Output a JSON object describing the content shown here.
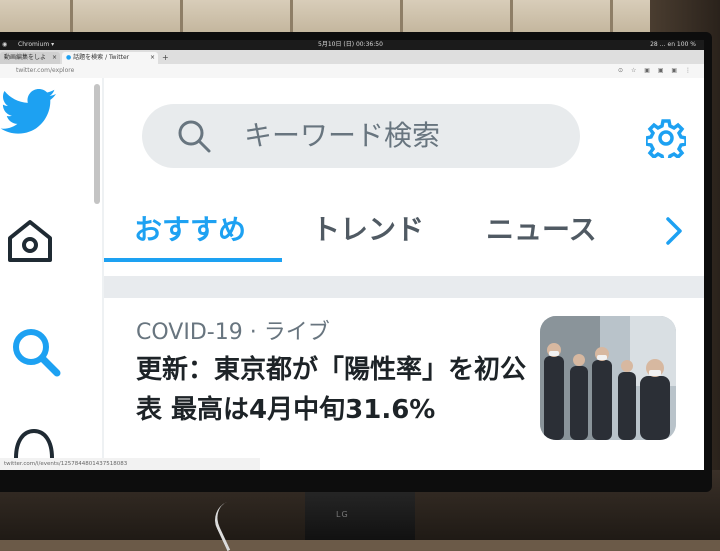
{
  "os_bar": {
    "app_name": "Chromium",
    "clock": "5月10日 (日) 00:36:50",
    "tray_text": "28 … en 100 %"
  },
  "browser": {
    "tabs": [
      {
        "label": "動画編集をしよ"
      },
      {
        "label": "話題を検索 / Twitter"
      }
    ],
    "new_tab": "+",
    "url": "twitter.com/explore",
    "status_url": "twitter.com/i/events/1257844801437518083"
  },
  "twitter": {
    "search_placeholder": "キーワード検索",
    "tabs": [
      "おすすめ",
      "トレンド",
      "ニュース"
    ],
    "active_tab_index": 0,
    "story": {
      "meta_topic": "COVID-19",
      "meta_dot": "·",
      "meta_type": "ライブ",
      "headline": "更新：東京都が「陽性率」を初公表 最高は4月中旬31.6%"
    }
  },
  "monitor": {
    "brand": "LG"
  },
  "colors": {
    "twitter_blue": "#1da1f2",
    "text_gray": "#68757f",
    "search_bg": "#e8ebed"
  },
  "icons": [
    "twitter-logo-icon",
    "home-icon",
    "search-icon",
    "bell-icon",
    "settings-gear-icon",
    "chevron-right-icon"
  ]
}
